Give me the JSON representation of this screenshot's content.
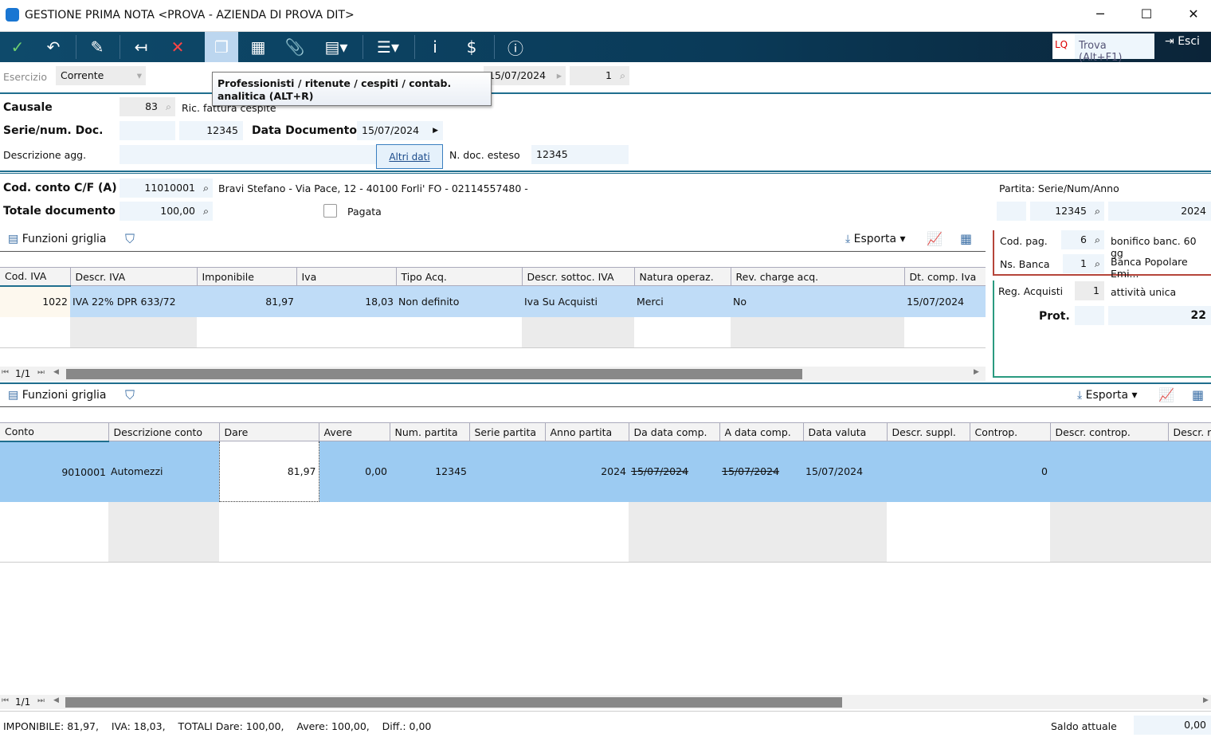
{
  "window": {
    "title": "GESTIONE PRIMA NOTA <PROVA - AZIENDA DI PROVA DIT>",
    "minimize": "─",
    "maximize": "☐",
    "close": "✕"
  },
  "toolbar": {
    "lq": "LQ",
    "find_placeholder": "Trova (Alt+F1)",
    "exit_label": "Esci"
  },
  "tooltip": {
    "text": "Professionisti / ritenute / cespiti / contab. analitica (ALT+R)"
  },
  "header": {
    "esercizio_label": "Esercizio",
    "esercizio_value": "Corrente",
    "data_reg": "15/07/2024",
    "num_reg": "1"
  },
  "form": {
    "causale_label": "Causale",
    "causale_code": "83",
    "causale_desc": "Ric. fattura cespite",
    "serie_label": "Serie/num. Doc.",
    "serie_value": "",
    "num_doc": "12345",
    "data_doc_label": "Data Documento",
    "data_doc": "15/07/2024",
    "descr_agg_label": "Descrizione agg.",
    "descr_agg": "",
    "altri_dati": "Altri dati",
    "ndoc_esteso_label": "N. doc. esteso",
    "ndoc_esteso": "12345",
    "conto_label": "Cod. conto C/F  (A)",
    "conto_code": "11010001",
    "conto_desc": "Bravi Stefano  - Via Pace, 12 - 40100 Forli' FO - 02114557480 -",
    "totale_label": "Totale documento",
    "totale": "100,00",
    "pagata_label": "Pagata"
  },
  "side": {
    "partita_label": "Partita: Serie/Num/Anno",
    "partita_serie": "",
    "partita_num": "12345",
    "partita_anno": "2024",
    "codpag_label": "Cod. pag.",
    "codpag": "6",
    "codpag_desc": "bonifico banc. 60 gg",
    "banca_label": "Ns. Banca",
    "banca": "1",
    "banca_desc": "Banca Popolare Emi...",
    "reg_label": "Reg. Acquisti",
    "reg": "1",
    "reg_desc": "attività unica",
    "prot_label": "Prot.",
    "prot_pre": "",
    "prot": "22"
  },
  "grid_toolbar": {
    "funzioni": "Funzioni griglia",
    "esporta": "Esporta"
  },
  "iva_table": {
    "columns": [
      "Cod. IVA",
      "Descr. IVA",
      "Imponibile",
      "Iva",
      "Tipo Acq.",
      "Descr. sottoc. IVA",
      "Natura operaz.",
      "Rev. charge acq.",
      "Dt. comp. Iva"
    ],
    "rows": [
      [
        "1022",
        "IVA 22% DPR 633/72",
        "81,97",
        "18,03",
        "Non definito",
        "Iva Su Acquisti",
        "Merci",
        "No",
        "15/07/2024"
      ]
    ],
    "pager": "1/1"
  },
  "moves_table": {
    "columns": [
      "Conto",
      "Descrizione conto",
      "Dare",
      "Avere",
      "Num. partita",
      "Serie partita",
      "Anno partita",
      "Da data comp.",
      "A data comp.",
      "Data valuta",
      "Descr. suppl.",
      "Controp.",
      "Descr. controp.",
      "Descr. ri"
    ],
    "rows": [
      [
        "9010001",
        "Automezzi",
        "81,97",
        "0,00",
        "12345",
        "",
        "2024",
        "15/07/2024",
        "15/07/2024",
        "15/07/2024",
        "",
        "0",
        "",
        ""
      ]
    ],
    "pager": "1/1"
  },
  "footer": {
    "summary": "IMPONIBILE: 81,97,    IVA: 18,03,    TOTALI Dare: 100,00,    Avere: 100,00,    Diff.: 0,00",
    "saldo_label": "Saldo attuale",
    "saldo": "0,00"
  }
}
